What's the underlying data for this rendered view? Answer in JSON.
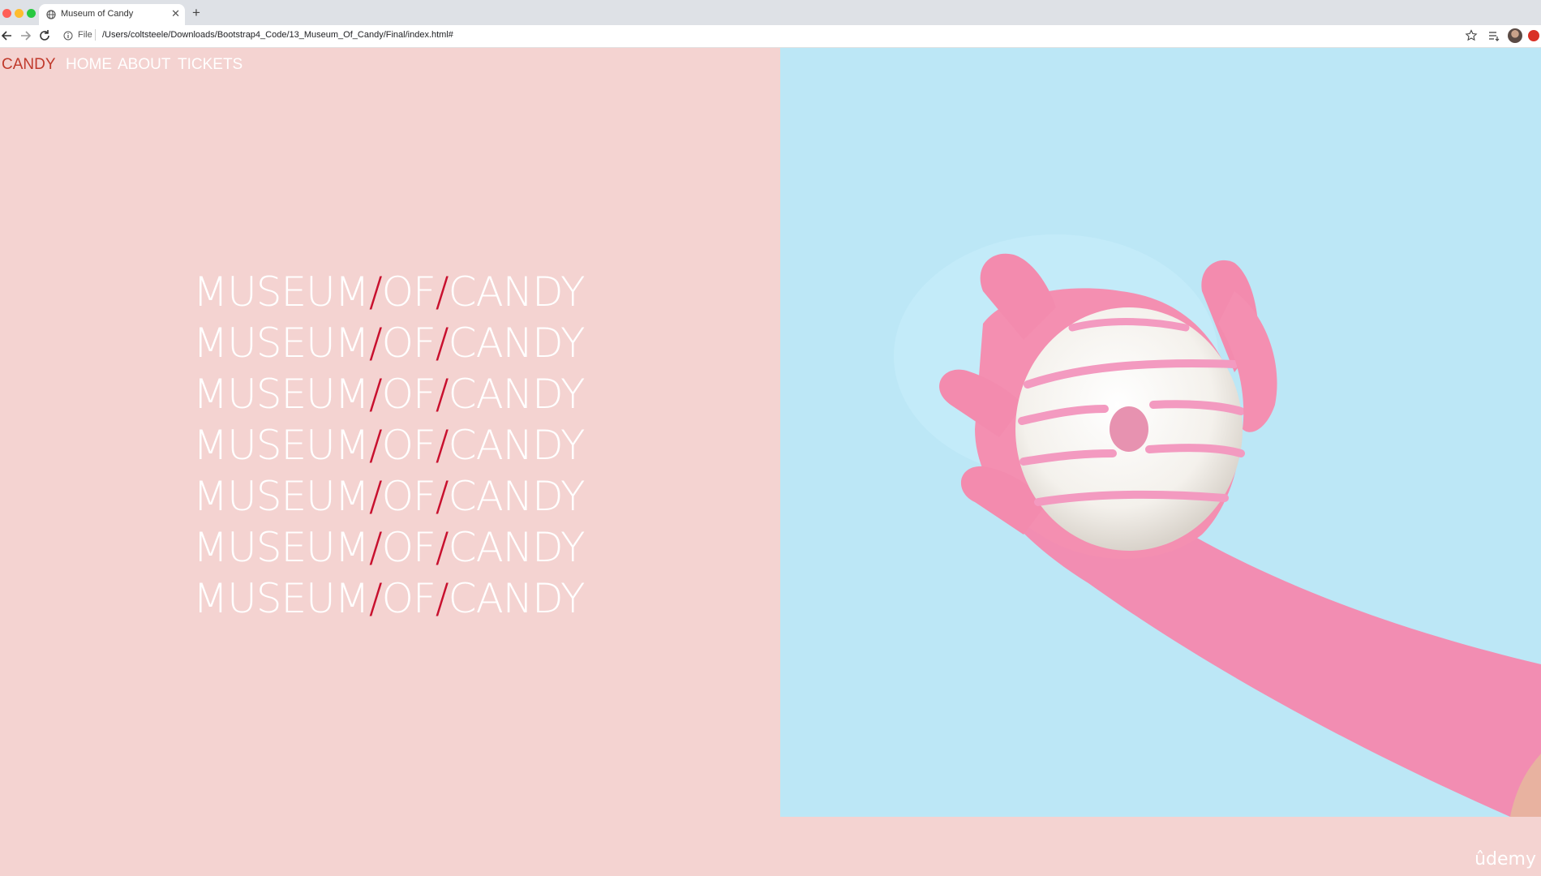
{
  "browser": {
    "tab_title": "Museum of Candy",
    "url_scheme": "File",
    "url": "/Users/coltsteele/Downloads/Bootstrap4_Code/13_Museum_Of_Candy/Final/index.html#"
  },
  "navbar": {
    "brand": "CANDY",
    "links": [
      "HOME",
      "ABOUT",
      "TICKETS"
    ]
  },
  "hero": {
    "rows": [
      {
        "a": "MUSEUM",
        "s1": "/",
        "b": "OF",
        "s2": "/",
        "c": "CANDY"
      },
      {
        "a": "MUSEUM",
        "s1": "/",
        "b": "OF",
        "s2": "/",
        "c": "CANDY"
      },
      {
        "a": "MUSEUM",
        "s1": "/",
        "b": "OF",
        "s2": "/",
        "c": "CANDY"
      },
      {
        "a": "MUSEUM",
        "s1": "/",
        "b": "OF",
        "s2": "/",
        "c": "CANDY"
      },
      {
        "a": "MUSEUM",
        "s1": "/",
        "b": "OF",
        "s2": "/",
        "c": "CANDY"
      },
      {
        "a": "MUSEUM",
        "s1": "/",
        "b": "OF",
        "s2": "/",
        "c": "CANDY"
      },
      {
        "a": "MUSEUM",
        "s1": "/",
        "b": "OF",
        "s2": "/",
        "c": "CANDY"
      }
    ]
  },
  "watermark": "ûdemy",
  "colors": {
    "page_bg": "#f4d3d1",
    "image_bg": "#bce7f6",
    "accent_red": "#c8102e",
    "glove_pink": "#f48fb1"
  },
  "icons": [
    "globe-icon",
    "close-icon",
    "plus-icon",
    "back-arrow-icon",
    "forward-arrow-icon",
    "reload-icon",
    "info-icon",
    "star-icon",
    "reading-list-icon"
  ]
}
